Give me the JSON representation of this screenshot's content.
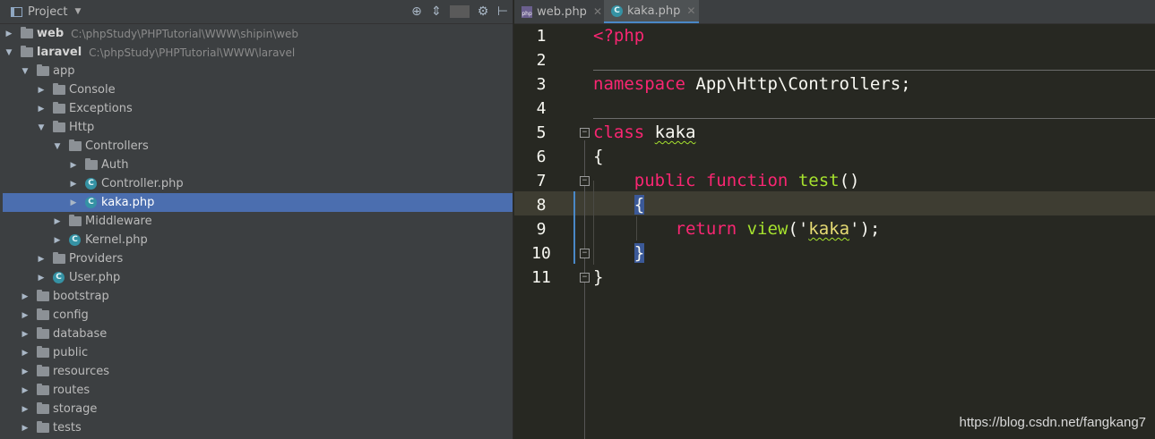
{
  "project_panel": {
    "title": "Project",
    "tree": [
      {
        "indent": 0,
        "expanded": false,
        "type": "folder",
        "label": "web",
        "path": "C:\\phpStudy\\PHPTutorial\\WWW\\shipin\\web",
        "bold": true
      },
      {
        "indent": 0,
        "expanded": true,
        "type": "folder",
        "label": "laravel",
        "path": "C:\\phpStudy\\PHPTutorial\\WWW\\laravel",
        "bold": true
      },
      {
        "indent": 1,
        "expanded": true,
        "type": "folder",
        "label": "app"
      },
      {
        "indent": 2,
        "expanded": false,
        "type": "folder",
        "label": "Console"
      },
      {
        "indent": 2,
        "expanded": false,
        "type": "folder",
        "label": "Exceptions"
      },
      {
        "indent": 2,
        "expanded": true,
        "type": "folder",
        "label": "Http"
      },
      {
        "indent": 3,
        "expanded": true,
        "type": "folder",
        "label": "Controllers"
      },
      {
        "indent": 4,
        "expanded": false,
        "type": "folder",
        "label": "Auth"
      },
      {
        "indent": 4,
        "expanded": false,
        "type": "class",
        "label": "Controller.php"
      },
      {
        "indent": 4,
        "expanded": false,
        "type": "class",
        "label": "kaka.php",
        "selected": true
      },
      {
        "indent": 3,
        "expanded": false,
        "type": "folder",
        "label": "Middleware"
      },
      {
        "indent": 3,
        "expanded": false,
        "type": "class",
        "label": "Kernel.php"
      },
      {
        "indent": 2,
        "expanded": false,
        "type": "folder",
        "label": "Providers"
      },
      {
        "indent": 2,
        "expanded": false,
        "type": "class",
        "label": "User.php"
      },
      {
        "indent": 1,
        "expanded": false,
        "type": "folder",
        "label": "bootstrap"
      },
      {
        "indent": 1,
        "expanded": false,
        "type": "folder",
        "label": "config"
      },
      {
        "indent": 1,
        "expanded": false,
        "type": "folder",
        "label": "database"
      },
      {
        "indent": 1,
        "expanded": false,
        "type": "folder",
        "label": "public"
      },
      {
        "indent": 1,
        "expanded": false,
        "type": "folder",
        "label": "resources"
      },
      {
        "indent": 1,
        "expanded": false,
        "type": "folder",
        "label": "routes"
      },
      {
        "indent": 1,
        "expanded": false,
        "type": "folder",
        "label": "storage"
      },
      {
        "indent": 1,
        "expanded": false,
        "type": "folder",
        "label": "tests"
      }
    ],
    "icons": {
      "locate": "crosshair-icon",
      "collapse": "collapse-all-icon",
      "settings": "gear-icon",
      "hide": "hide-panel-icon"
    }
  },
  "tabs": [
    {
      "label": "web.php",
      "icon": "php-file-icon",
      "active": false
    },
    {
      "label": "kaka.php",
      "icon": "php-class-icon",
      "active": true
    }
  ],
  "editor": {
    "line_numbers": [
      "1",
      "2",
      "3",
      "4",
      "5",
      "6",
      "7",
      "8",
      "9",
      "10",
      "11"
    ],
    "current_line": "8",
    "code": {
      "l1": "<?php",
      "l3_kw": "namespace",
      "l3_rest": " App\\Http\\Controllers;",
      "l5_kw": "class",
      "l5_name": "kaka",
      "l6": "{",
      "l7_kw1": "public",
      "l7_kw2": "function",
      "l7_fn": "test",
      "l7_rest": "()",
      "l8": "{",
      "l9_kw": "return",
      "l9_fn": "view",
      "l9_open": "('",
      "l9_str": "kaka",
      "l9_close": "');",
      "l10": "}",
      "l11": "}"
    }
  },
  "watermark": "https://blog.csdn.net/fangkang7",
  "colors": {
    "keyword": "#f92672",
    "function": "#a6e22e",
    "string": "#e6db74",
    "selection": "#4b6eaf",
    "background": "#272822"
  }
}
